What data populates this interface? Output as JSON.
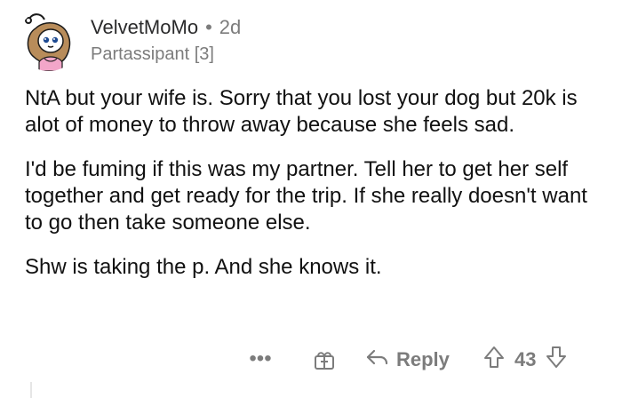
{
  "comment": {
    "username": "VelvetMoMo",
    "separator": "•",
    "age": "2d",
    "flair": "Partassipant [3]",
    "paragraphs": [
      "NtA but your wife is. Sorry that you lost your dog but 20k is alot of money to throw away because she feels sad.",
      "I'd be fuming if this was my partner. Tell her to get her self together and get ready for the trip. If she really doesn't want to go then take someone else.",
      "Shw is taking the p. And she knows it."
    ]
  },
  "actions": {
    "more": "•••",
    "reply_label": "Reply",
    "score": "43"
  },
  "icons": {
    "avatar": "avatar-icon",
    "award": "gift-award-icon",
    "reply": "reply-arrow-icon",
    "upvote": "upvote-arrow-icon",
    "downvote": "downvote-arrow-icon",
    "more": "more-options-icon"
  },
  "colors": {
    "meta_gray": "#7c7c7c",
    "text": "#111111"
  }
}
